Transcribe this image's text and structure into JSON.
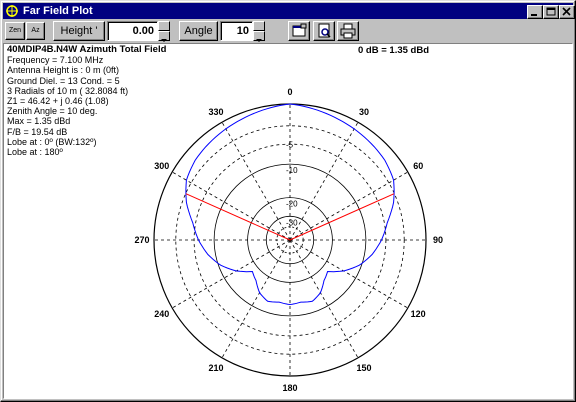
{
  "window": {
    "title": "Far Field Plot"
  },
  "toolbar": {
    "zenith_label": "Zen",
    "azimuth_label": "Az",
    "height_label": "Height '",
    "height_value": "0.00",
    "angle_label": "Angle",
    "angle_value": "10"
  },
  "info": {
    "header": "40MDIP4B.N4W Azimuth Total Field",
    "lines": [
      "Frequency = 7.100 MHz",
      "Antenna Height is : 0 m  (0ft)",
      "Ground Diel. = 13  Cond. = 5",
      " 3 Radials of 10 m  ( 32.8084 ft)",
      "Z1 = 46.42 + j 0.46 (1.08)",
      "Zenith Angle = 10 deg.",
      "Max = 1.35 dBd",
      "F/B = 19.54 dB",
      "Lobe at : 0º (BW:132º)",
      "Lobe at : 180º"
    ],
    "gain_reference": "0 dB = 1.35 dBd"
  },
  "polar": {
    "angle_labels": [
      "0",
      "30",
      "60",
      "90",
      "120",
      "150",
      "180",
      "210",
      "240",
      "270",
      "300",
      "330"
    ],
    "ring_labels": [
      "-5",
      "-10",
      "-20",
      "-30"
    ],
    "pattern_color": "#0000ff",
    "beamwidth_color": "#ff0000",
    "beamwidth_deg": 132,
    "pattern_db": [
      [
        0,
        0
      ],
      [
        20,
        -0.7
      ],
      [
        40,
        -1.3
      ],
      [
        50,
        -1.6
      ],
      [
        60,
        -2.2
      ],
      [
        70,
        -3.6
      ],
      [
        80,
        -5.5
      ],
      [
        90,
        -6.8
      ],
      [
        100,
        -8.4
      ],
      [
        110,
        -10.5
      ],
      [
        120,
        -13.5
      ],
      [
        130,
        -17.5
      ],
      [
        140,
        -16.2
      ],
      [
        150,
        -13.8
      ],
      [
        160,
        -12.6
      ],
      [
        170,
        -13.2
      ],
      [
        180,
        -12.8
      ],
      [
        190,
        -13.2
      ],
      [
        200,
        -12.6
      ],
      [
        210,
        -13.8
      ],
      [
        220,
        -16.2
      ],
      [
        230,
        -17.5
      ],
      [
        240,
        -13.5
      ],
      [
        250,
        -10.5
      ],
      [
        260,
        -8.4
      ],
      [
        270,
        -6.8
      ],
      [
        280,
        -5.5
      ],
      [
        290,
        -3.6
      ],
      [
        300,
        -2.2
      ],
      [
        310,
        -1.6
      ],
      [
        320,
        -1.3
      ],
      [
        340,
        -0.7
      ],
      [
        360,
        0
      ]
    ]
  }
}
